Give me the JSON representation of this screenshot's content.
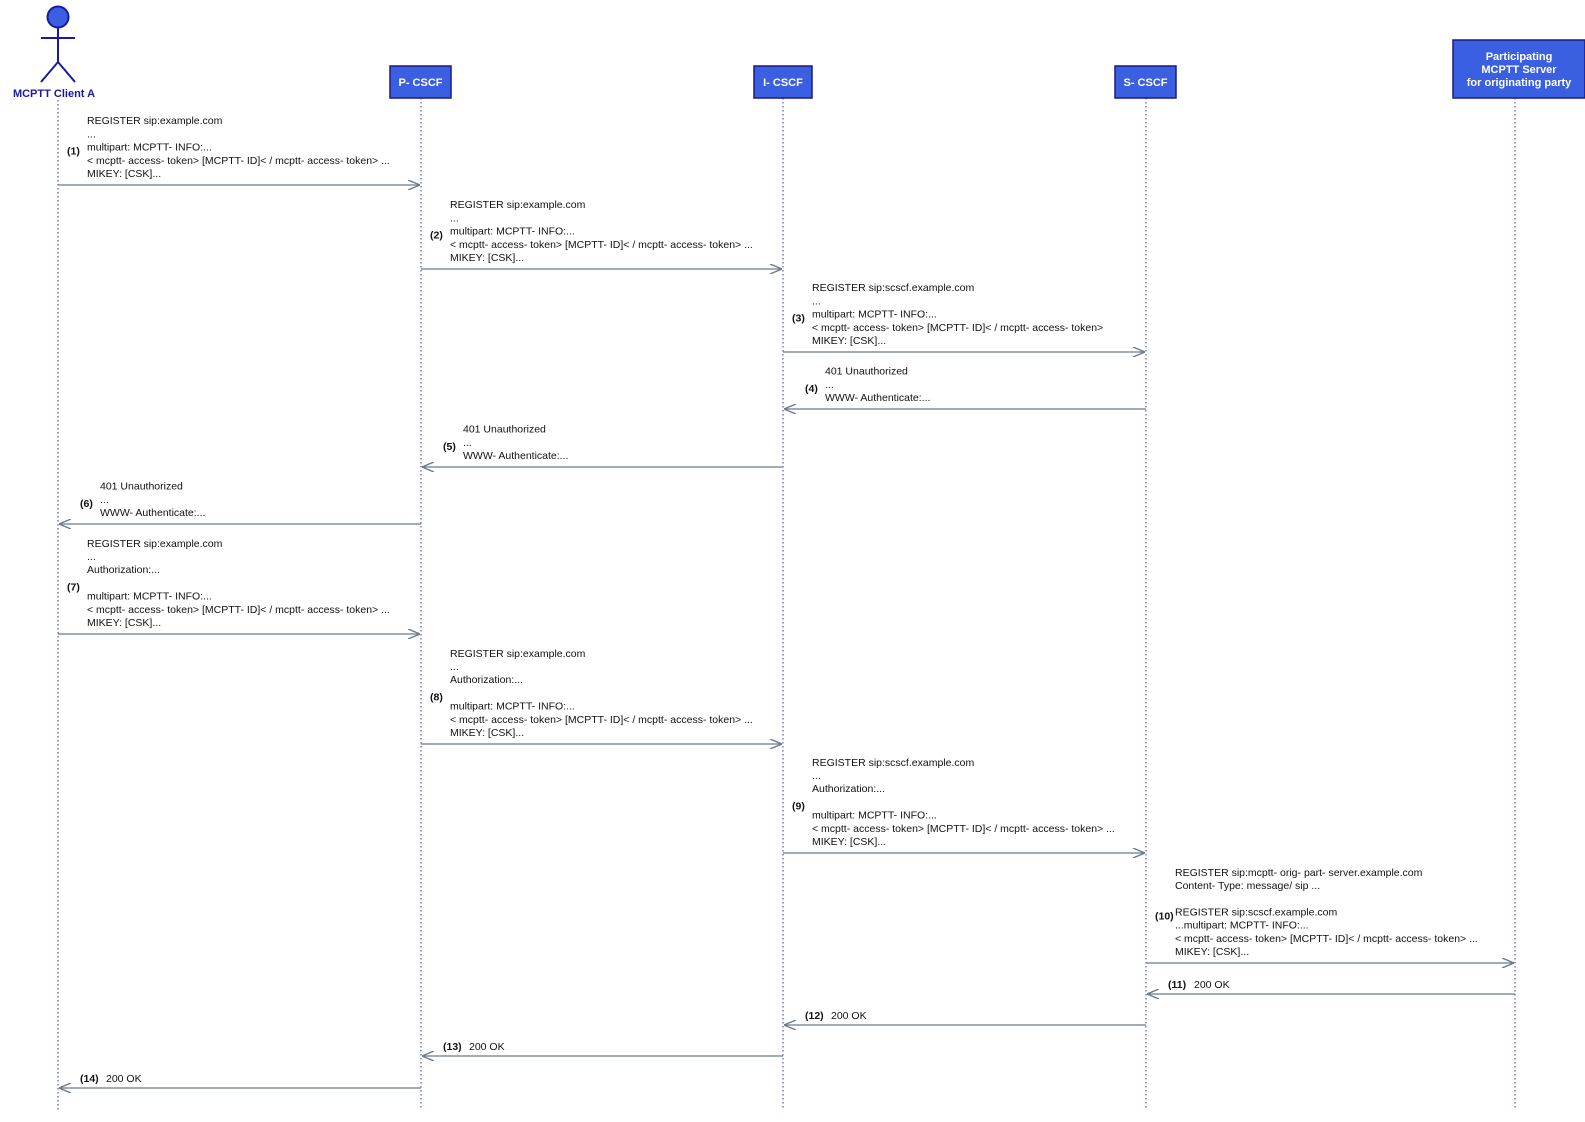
{
  "colors": {
    "participant_fill": "#3a5fe0",
    "participant_border": "#1a1a80",
    "actor_fill": "#3a5fe0",
    "actor_stroke": "#1a1aa0",
    "arrow": "#6b7a8f",
    "lifeline": "#3a3ab0"
  },
  "participants": [
    {
      "id": "client",
      "kind": "actor",
      "label": "MCPTT Client A"
    },
    {
      "id": "pcscf",
      "kind": "box",
      "label": "P- CSCF"
    },
    {
      "id": "icscf",
      "kind": "box",
      "label": "I- CSCF"
    },
    {
      "id": "scscf",
      "kind": "box",
      "label": "S- CSCF"
    },
    {
      "id": "server",
      "kind": "box",
      "label": "Participating MCPTT Server for originating party",
      "lines": [
        "Participating",
        "MCPTT Server",
        "for originating party"
      ]
    }
  ],
  "messages": [
    {
      "num": "(1)",
      "from": "client",
      "to": "pcscf",
      "lines": [
        "REGISTER sip:example.com",
        "...",
        " multipart: MCPTT- INFO:...",
        "< mcptt- access- token> [MCPTT- ID]< / mcptt- access- token> ...",
        " MIKEY: [CSK]..."
      ]
    },
    {
      "num": "(2)",
      "from": "pcscf",
      "to": "icscf",
      "lines": [
        "REGISTER sip:example.com",
        "...",
        " multipart: MCPTT- INFO:...",
        "< mcptt- access- token> [MCPTT- ID]< / mcptt- access- token> ...",
        " MIKEY: [CSK]..."
      ]
    },
    {
      "num": "(3)",
      "from": "icscf",
      "to": "scscf",
      "lines": [
        "REGISTER sip:scscf.example.com",
        "...",
        " multipart: MCPTT- INFO:...",
        "< mcptt- access- token> [MCPTT- ID]< / mcptt- access- token>",
        " MIKEY: [CSK]..."
      ]
    },
    {
      "num": "(4)",
      "from": "scscf",
      "to": "icscf",
      "lines": [
        "401 Unauthorized",
        "...",
        "WWW- Authenticate:..."
      ]
    },
    {
      "num": "(5)",
      "from": "icscf",
      "to": "pcscf",
      "lines": [
        "401 Unauthorized",
        "...",
        "WWW- Authenticate:..."
      ]
    },
    {
      "num": "(6)",
      "from": "pcscf",
      "to": "client",
      "lines": [
        "401 Unauthorized",
        "...",
        "WWW- Authenticate:..."
      ]
    },
    {
      "num": "(7)",
      "from": "client",
      "to": "pcscf",
      "lines": [
        "REGISTER sip:example.com",
        "...",
        "Authorization:...",
        "",
        " multipart: MCPTT- INFO:...",
        "< mcptt- access- token> [MCPTT- ID]< / mcptt- access- token> ...",
        " MIKEY: [CSK]..."
      ]
    },
    {
      "num": "(8)",
      "from": "pcscf",
      "to": "icscf",
      "lines": [
        "REGISTER sip:example.com",
        "...",
        "Authorization:...",
        "",
        " multipart: MCPTT- INFO:...",
        "< mcptt- access- token> [MCPTT- ID]< / mcptt- access- token> ...",
        " MIKEY: [CSK]..."
      ]
    },
    {
      "num": "(9)",
      "from": "icscf",
      "to": "scscf",
      "lines": [
        "REGISTER sip:scscf.example.com",
        "...",
        "Authorization:...",
        "",
        " multipart: MCPTT- INFO:...",
        "< mcptt- access- token> [MCPTT- ID]< / mcptt- access- token> ...",
        " MIKEY: [CSK]..."
      ]
    },
    {
      "num": "(10)",
      "from": "scscf",
      "to": "server",
      "lines": [
        "REGISTER sip:mcptt- orig- part- server.example.com",
        "Content- Type: message/ sip ...",
        "",
        "REGISTER sip:scscf.example.com",
        "...multipart: MCPTT- INFO:...",
        "< mcptt- access- token> [MCPTT- ID]< / mcptt- access- token> ...",
        " MIKEY: [CSK]..."
      ]
    },
    {
      "num": "(11)",
      "from": "server",
      "to": "scscf",
      "lines": [
        "200 OK"
      ]
    },
    {
      "num": "(12)",
      "from": "scscf",
      "to": "icscf",
      "lines": [
        "200 OK"
      ]
    },
    {
      "num": "(13)",
      "from": "icscf",
      "to": "pcscf",
      "lines": [
        "200 OK"
      ]
    },
    {
      "num": "(14)",
      "from": "pcscf",
      "to": "client",
      "lines": [
        "200 OK"
      ]
    }
  ]
}
